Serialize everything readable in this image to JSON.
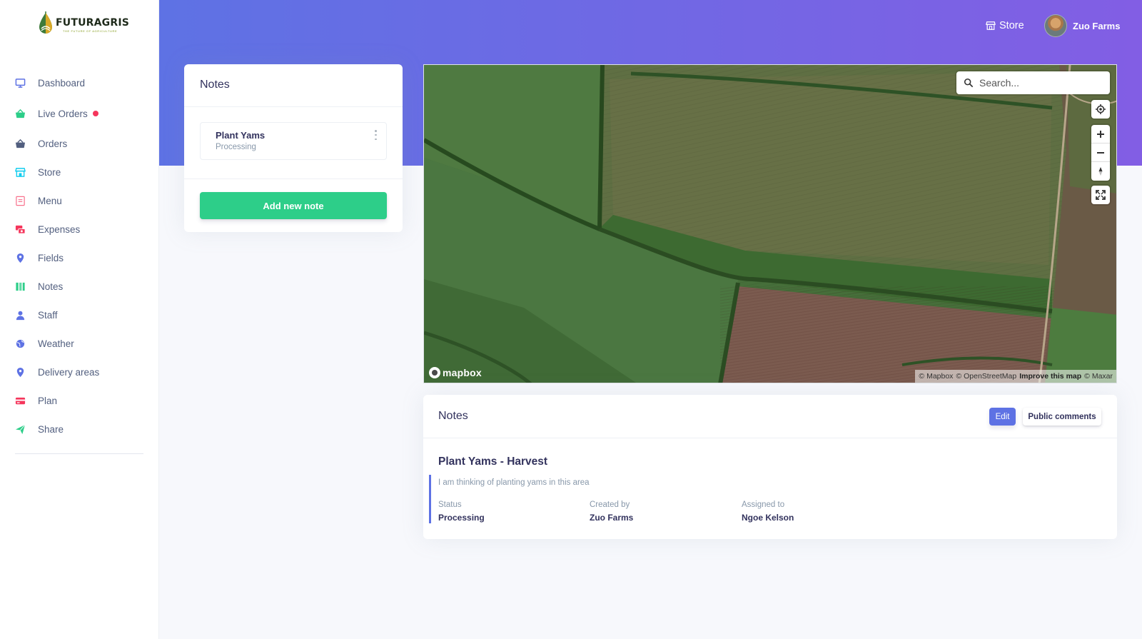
{
  "brand": {
    "name": "FUTURAGRIS",
    "tagline": "THE FUTURE OF AGRICULTURE"
  },
  "sidebar": {
    "items": [
      {
        "label": "Dashboard",
        "icon": "monitor-icon",
        "color": "#5e72e4"
      },
      {
        "label": "Live Orders",
        "icon": "basket-icon",
        "color": "#2dce89",
        "badge": "live-dot"
      },
      {
        "label": "Orders",
        "icon": "basket-icon",
        "color": "#525f7f"
      },
      {
        "label": "Store",
        "icon": "store-icon",
        "color": "#11cdef"
      },
      {
        "label": "Menu",
        "icon": "menu-book-icon",
        "color": "#f5365c"
      },
      {
        "label": "Expenses",
        "icon": "money-icon",
        "color": "#f5365c"
      },
      {
        "label": "Fields",
        "icon": "map-pin-icon",
        "color": "#5e72e4"
      },
      {
        "label": "Notes",
        "icon": "notes-icon",
        "color": "#2dce89"
      },
      {
        "label": "Staff",
        "icon": "person-icon",
        "color": "#5e72e4"
      },
      {
        "label": "Weather",
        "icon": "globe-icon",
        "color": "#5e72e4"
      },
      {
        "label": "Delivery areas",
        "icon": "map-pin-icon",
        "color": "#5e72e4"
      },
      {
        "label": "Plan",
        "icon": "credit-card-icon",
        "color": "#f5365c"
      },
      {
        "label": "Share",
        "icon": "send-icon",
        "color": "#2dce89"
      }
    ]
  },
  "topbar": {
    "store_label": "Store",
    "user_name": "Zuo Farms"
  },
  "notes_panel": {
    "title": "Notes",
    "items": [
      {
        "title": "Plant Yams",
        "status": "Processing"
      }
    ],
    "add_button": "Add new note"
  },
  "map": {
    "search_placeholder": "Search...",
    "logo": "mapbox",
    "attribution": {
      "mapbox": "© Mapbox",
      "osm": "© OpenStreetMap",
      "improve": "Improve this map",
      "maxar": "© Maxar"
    }
  },
  "note_detail": {
    "header": "Notes",
    "edit_button": "Edit",
    "comments_button": "Public comments",
    "title": "Plant Yams - Harvest",
    "description": "I am thinking of planting yams in this area",
    "status_label": "Status",
    "status_value": "Processing",
    "created_label": "Created by",
    "created_value": "Zuo Farms",
    "assigned_label": "Assigned to",
    "assigned_value": "Ngoe Kelson"
  },
  "colors": {
    "accent": "#5e72e4",
    "success": "#2dce89",
    "danger": "#f5365c",
    "gradient_end": "#825ee4"
  }
}
